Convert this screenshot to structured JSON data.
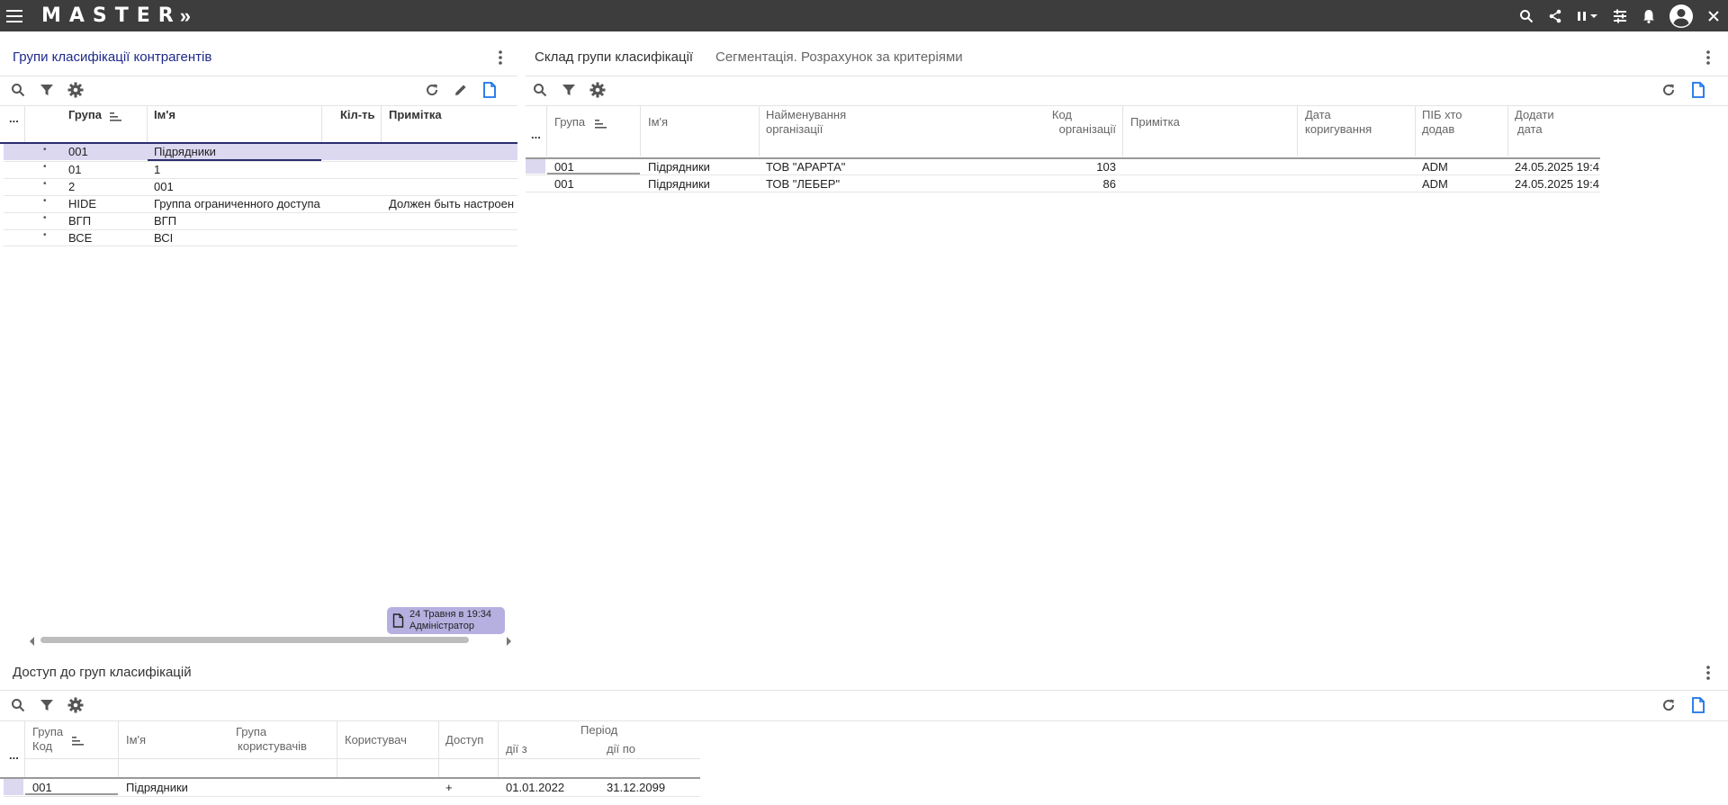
{
  "app": {
    "logo": "MASTER",
    "logo_suffix": "»"
  },
  "icons": {
    "menu": "menu-icon",
    "search": "search-icon",
    "share": "share-icon",
    "pause": "pause-icon",
    "tune": "tune-icon",
    "bell": "bell-icon",
    "account": "account-icon",
    "close": "close-icon",
    "filter": "filter-icon",
    "gear": "gear-icon",
    "refresh": "refresh-icon",
    "edit": "pencil-icon",
    "new_doc": "new-document-icon",
    "kebab": "more-vert-icon"
  },
  "colors": {
    "topbar": "#3d3d3d",
    "accent": "#1a73e8",
    "selected_row": "#dcd8f0",
    "badge": "#b6b0e0",
    "active_title": "#1f2a8a"
  },
  "left_panel": {
    "title": "Групи класифікації контрагентів",
    "columns": {
      "more": "...",
      "group": "Група",
      "name": "Ім'я",
      "count": "Кіл-ть",
      "note": "Примітка"
    },
    "rows": [
      {
        "group": "001",
        "name": "Підрядники",
        "count": "",
        "note": ""
      },
      {
        "group": "01",
        "name": "1",
        "count": "",
        "note": ""
      },
      {
        "group": "2",
        "name": "001",
        "count": "",
        "note": ""
      },
      {
        "group": "HIDE",
        "name": "Группа ограниченного доступа",
        "count": "",
        "note": "Должен быть настроен"
      },
      {
        "group": "ВГП",
        "name": "ВГП",
        "count": "",
        "note": ""
      },
      {
        "group": "ВСЕ",
        "name": "ВСІ",
        "count": "",
        "note": ""
      }
    ],
    "badge": {
      "line1": "24 Травня в 19:34",
      "line2": "Адміністратор"
    }
  },
  "right_panel": {
    "tab_active": "Склад групи класифікації",
    "tab_other": "Сегментація. Розрахунок за критеріями",
    "columns": {
      "more": "...",
      "group": "Група",
      "name": "Ім'я",
      "org_name_1": "Найменування",
      "org_name_2": "організації",
      "org_code_1": "Код",
      "org_code_2": "організації",
      "note": "Примітка",
      "edit_date_1": "Дата",
      "edit_date_2": "коригування",
      "added_by_1": "ПІБ хто",
      "added_by_2": "додав",
      "add_date_1": "Додати",
      "add_date_2": "дата"
    },
    "rows": [
      {
        "group": "001",
        "name": "Підрядники",
        "org": "ТОВ \"АРАРТА\"",
        "code": "103",
        "note": "",
        "edit_date": "",
        "added_by": "ADM",
        "add_date": "24.05.2025 19:4"
      },
      {
        "group": "001",
        "name": "Підрядники",
        "org": "ТОВ \"ЛЕБЕР\"",
        "code": "86",
        "note": "",
        "edit_date": "",
        "added_by": "ADM",
        "add_date": "24.05.2025 19:4"
      }
    ]
  },
  "bottom_panel": {
    "title": "Доступ до груп класифікацій",
    "columns": {
      "more": "...",
      "group_1": "Група",
      "group_2": "Код",
      "name": "Ім'я",
      "user_group_1": "Група",
      "user_group_2": "користувачів",
      "user": "Користувач",
      "access": "Доступ",
      "period": "Період",
      "from": "дії з",
      "to": "дії по"
    },
    "rows": [
      {
        "code": "001",
        "name": "Підрядники",
        "user_group": "",
        "user": "",
        "access": "+",
        "from": "01.01.2022",
        "to": "31.12.2099"
      }
    ]
  }
}
